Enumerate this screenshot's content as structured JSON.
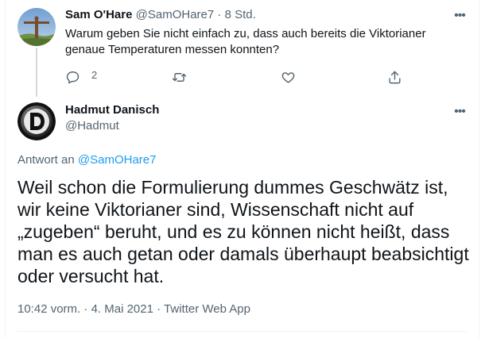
{
  "tweet1": {
    "author_name": "Sam O'Hare",
    "handle": "@SamOHare7",
    "separator": "·",
    "time": "8 Std.",
    "text": "Warum geben Sie nicht einfach zu, dass auch bereits die Viktorianer genaue Temperaturen messen konnten?",
    "reply_count": "2",
    "more_label": "•••"
  },
  "tweet2": {
    "author_name": "Hadmut Danisch",
    "handle": "@Hadmut",
    "more_label": "•••",
    "reply_prefix": "Antwort an",
    "reply_to_handle": "@SamOHare7",
    "text": "Weil schon die Formulierung dummes Geschwätz ist, wir keine Viktorianer sind, Wissenschaft nicht auf „zugeben“ beruht, und es zu können nicht heißt, dass man es auch getan oder damals überhaupt beabsichtigt oder versucht hat.",
    "time": "10:42 vorm.",
    "separator": "·",
    "date": "4. Mai 2021",
    "source": "Twitter Web App"
  },
  "icons": {
    "reply": "reply-icon",
    "retweet": "retweet-icon",
    "like": "heart-icon",
    "share": "share-icon",
    "more": "more-icon"
  },
  "colors": {
    "accent": "#1d9bf0",
    "muted": "#536471",
    "text": "#0f1419",
    "thread_line": "#cfd9de"
  }
}
